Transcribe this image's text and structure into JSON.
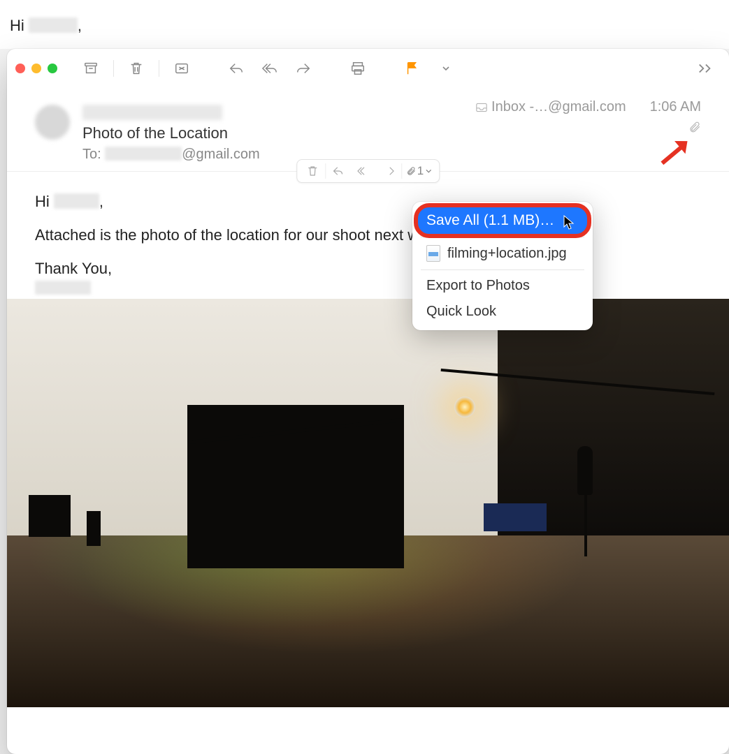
{
  "background": {
    "greeting_prefix": "Hi ",
    "greeting_suffix": ","
  },
  "toolbar": {
    "icons": [
      "archive",
      "trash",
      "junk",
      "reply",
      "reply-all",
      "forward",
      "print",
      "flag",
      "flag-caret",
      "overflow"
    ]
  },
  "header": {
    "subject": "Photo of the Location",
    "to_label": "To:",
    "to_suffix": "@gmail.com",
    "inbox_label": "Inbox -…@gmail.com",
    "time": "1:06 AM"
  },
  "inline_actions": {
    "attach_count": "1"
  },
  "body": {
    "greeting_prefix": "Hi ",
    "greeting_suffix": ",",
    "line1": "Attached is the photo of the location for our shoot next week.",
    "thanks": "Thank You,"
  },
  "dropdown": {
    "save_all": "Save All (1.1 MB)…",
    "file": "filming+location.jpg",
    "export": "Export to Photos",
    "quicklook": "Quick Look"
  }
}
